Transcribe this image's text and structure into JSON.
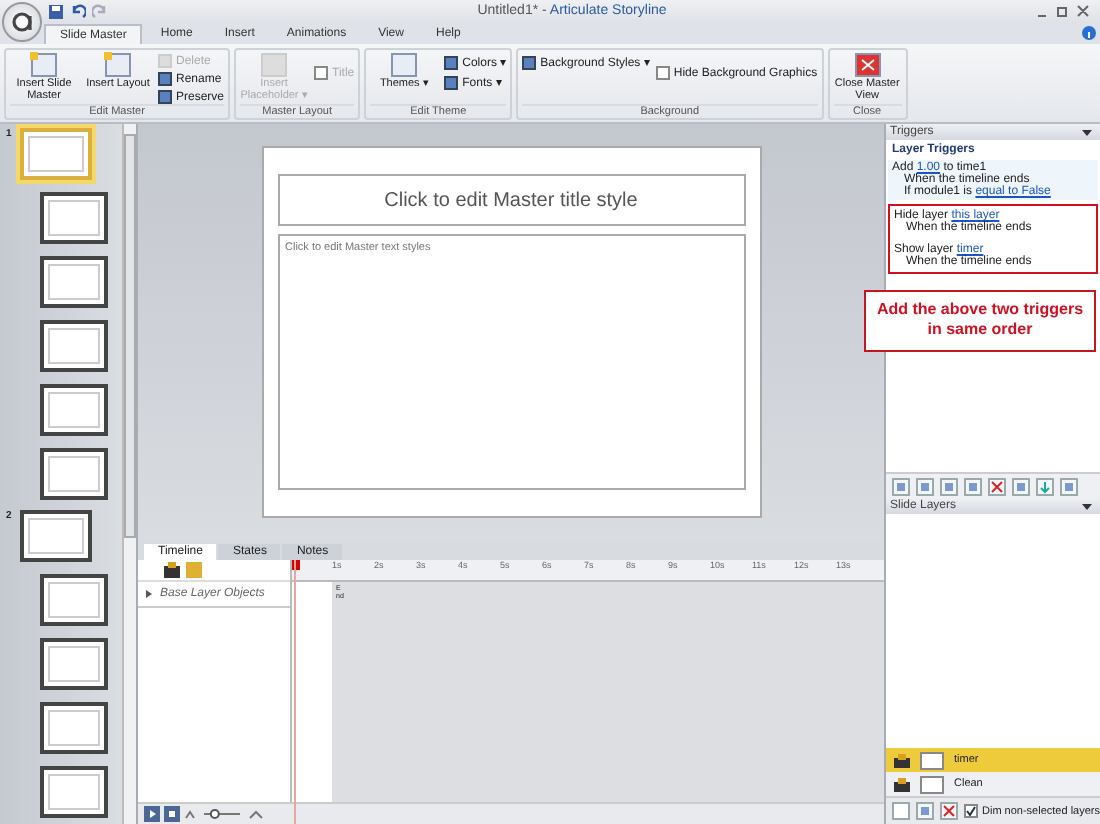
{
  "window": {
    "doc_title": "Untitled1* -",
    "app_name": "Articulate Storyline"
  },
  "tabs": [
    {
      "label": "Slide Master",
      "selected": true
    },
    {
      "label": "Home",
      "selected": false
    },
    {
      "label": "Insert",
      "selected": false
    },
    {
      "label": "Animations",
      "selected": false
    },
    {
      "label": "View",
      "selected": false
    },
    {
      "label": "Help",
      "selected": false
    }
  ],
  "ribbon": [
    {
      "label": "Edit Master",
      "items": [
        {
          "kind": "big",
          "label": "Insert Slide Master",
          "disabled": false
        },
        {
          "kind": "big",
          "label": "Insert Layout",
          "disabled": false
        },
        {
          "kind": "stack",
          "entries": [
            {
              "label": "Delete",
              "disabled": true
            },
            {
              "label": "Rename",
              "disabled": false
            },
            {
              "label": "Preserve",
              "disabled": false
            }
          ]
        }
      ]
    },
    {
      "label": "Master Layout",
      "items": [
        {
          "kind": "big",
          "label": "Insert Placeholder ▾",
          "disabled": true
        },
        {
          "kind": "check",
          "label": "Title",
          "checked": false,
          "disabled": true
        }
      ]
    },
    {
      "label": "Edit Theme",
      "items": [
        {
          "kind": "big",
          "label": "Themes ▾",
          "disabled": false
        },
        {
          "kind": "stack",
          "entries": [
            {
              "label": "Colors ▾",
              "disabled": false
            },
            {
              "label": "Fonts ▾",
              "disabled": false
            }
          ]
        }
      ]
    },
    {
      "label": "Background",
      "items": [
        {
          "kind": "stack",
          "entries": [
            {
              "label": "Background Styles ▾",
              "disabled": false
            }
          ]
        },
        {
          "kind": "check",
          "label": "Hide Background Graphics",
          "checked": false,
          "disabled": false
        }
      ]
    },
    {
      "label": "Close",
      "items": [
        {
          "kind": "big",
          "label": "Close Master View",
          "disabled": false
        }
      ]
    }
  ],
  "thumbnails": [
    {
      "number": "1",
      "selected": true,
      "nested": false
    },
    {
      "selected": false,
      "nested": true
    },
    {
      "selected": false,
      "nested": true
    },
    {
      "selected": false,
      "nested": true
    },
    {
      "selected": false,
      "nested": true
    },
    {
      "selected": false,
      "nested": true
    },
    {
      "number": "2",
      "selected": false,
      "nested": false
    },
    {
      "selected": false,
      "nested": true
    },
    {
      "selected": false,
      "nested": true
    },
    {
      "selected": false,
      "nested": true
    },
    {
      "selected": false,
      "nested": true
    }
  ],
  "slide": {
    "title_placeholder": "Click to edit Master title style",
    "text_placeholder": "Click to edit Master text styles"
  },
  "timeline": {
    "tabs": [
      {
        "label": "Timeline",
        "selected": true
      },
      {
        "label": "States",
        "selected": false
      },
      {
        "label": "Notes",
        "selected": false
      }
    ],
    "rows": [
      "Base Layer Objects"
    ],
    "ruler": [
      "1s",
      "2s",
      "3s",
      "4s",
      "5s",
      "6s",
      "7s",
      "8s",
      "9s",
      "10s",
      "11s",
      "12s",
      "13s"
    ],
    "end_label": "End",
    "zoom": {
      "level": 0.3
    }
  },
  "triggers": {
    "title": "Triggers",
    "group": "Layer Triggers",
    "items": [
      {
        "action": "Add",
        "link": "1.00",
        "rest": "to time1",
        "when": "When the timeline ends",
        "condition": "If module1 is",
        "condition_link": "equal to False",
        "highlighted": false
      },
      {
        "action": "Hide layer",
        "link": "this layer",
        "when": "When the timeline ends",
        "highlighted": true
      },
      {
        "action": "Show layer",
        "link": "timer",
        "when": "When the timeline ends",
        "highlighted": true
      }
    ],
    "callout": "Add the above two triggers in same order"
  },
  "slide_layers": {
    "title": "Slide Layers",
    "layers": [
      {
        "name": "timer",
        "selected": true
      },
      {
        "name": "Clean",
        "selected": false
      }
    ],
    "dim_label": "Dim non-selected layers",
    "dim_checked": true
  }
}
